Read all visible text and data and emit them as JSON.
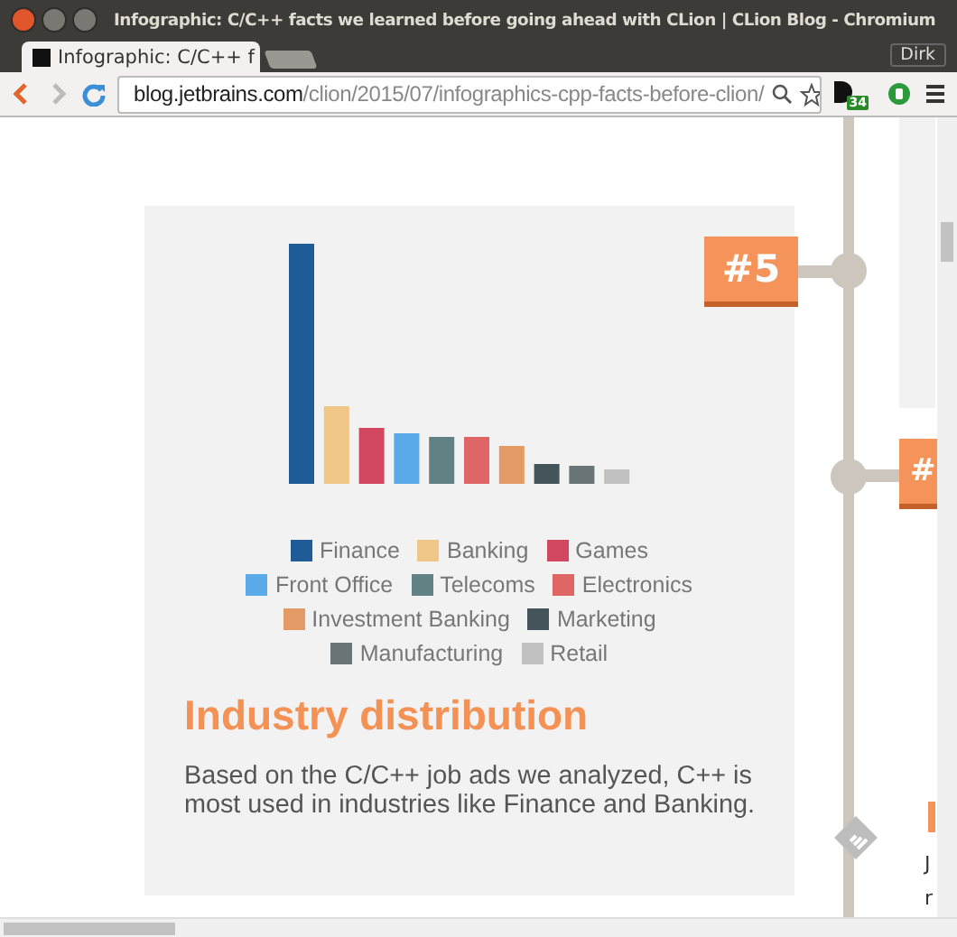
{
  "window": {
    "title": "Infographic: C/C++ facts we learned before going ahead with CLion | CLion Blog - Chromium",
    "user": "Dirk"
  },
  "tabs": [
    {
      "label": "Infographic: C/C++ f",
      "selected": true
    }
  ],
  "address_bar": {
    "host": "blog.jetbrains.com",
    "path": "/clion/2015/07/infographics-cpp-facts-before-clion/"
  },
  "extensions": [
    {
      "badge": "34"
    }
  ],
  "card": {
    "legend_rows": [
      [
        {
          "label": "Finance",
          "color": "#1f5b96"
        },
        {
          "label": "Banking",
          "color": "#efc685"
        },
        {
          "label": "Games",
          "color": "#d24660"
        }
      ],
      [
        {
          "label": "Front Office",
          "color": "#5aa9e9"
        },
        {
          "label": "Telecoms",
          "color": "#628184"
        },
        {
          "label": "Electronics",
          "color": "#e06666"
        }
      ],
      [
        {
          "label": "Investment Banking",
          "color": "#e39a64"
        },
        {
          "label": "Marketing",
          "color": "#43545a"
        }
      ],
      [
        {
          "label": "Manufacturing",
          "color": "#687476"
        },
        {
          "label": "Retail",
          "color": "#c0c0c0"
        }
      ]
    ],
    "title": "Industry distribution",
    "text": "Based on the C/C++ job ads we analyzed, C++ is most used in industries like Finance and Banking."
  },
  "timeline": {
    "badges": [
      {
        "label": "#5"
      },
      {
        "label": "#"
      }
    ]
  },
  "side_fragments": [
    "J",
    "r"
  ]
}
